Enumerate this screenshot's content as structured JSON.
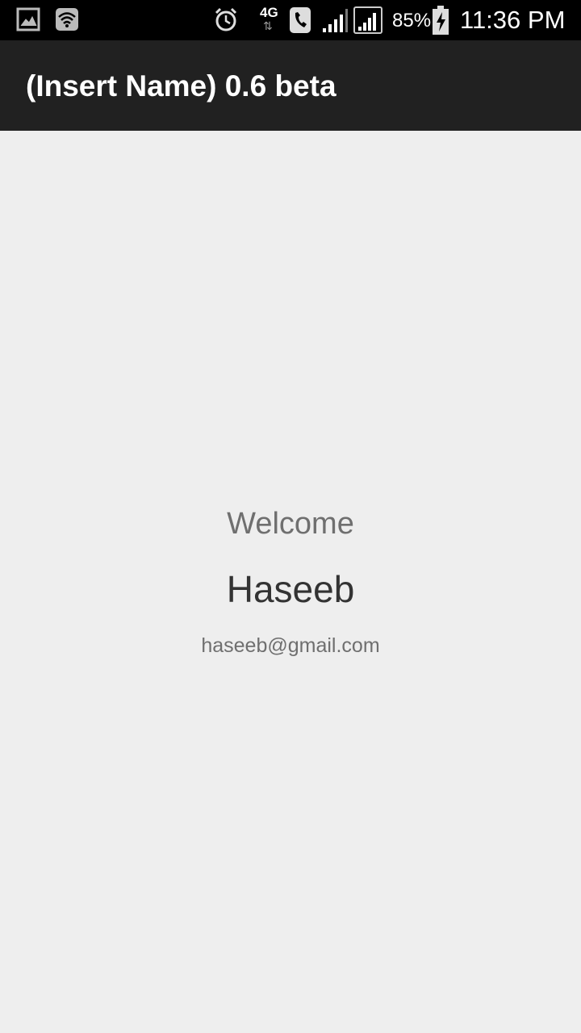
{
  "status_bar": {
    "icons": [
      "gallery-icon",
      "wifi-icon",
      "alarm-icon",
      "network-4g-icon",
      "call-icon",
      "signal-icon",
      "signal-icon",
      "battery-charging-icon"
    ],
    "network_label": "4G",
    "battery_percent": "85%",
    "time": "11:36 PM"
  },
  "app_bar": {
    "title": "(Insert Name) 0.6 beta",
    "background": "#212121"
  },
  "main": {
    "welcome": "Welcome",
    "user_name": "Haseeb",
    "user_email": "haseeb@gmail.com"
  }
}
